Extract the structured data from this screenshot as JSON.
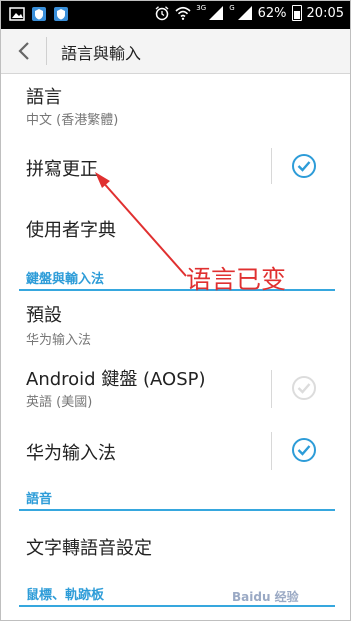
{
  "status_bar": {
    "net_3g": "3G",
    "net_g": "G",
    "battery": "62%",
    "time": "20:05"
  },
  "action_bar": {
    "title": "語言與輸入"
  },
  "items": {
    "language": {
      "title": "語言",
      "summary": "中文 (香港繁體)"
    },
    "spell": {
      "title": "拼寫更正",
      "checked": true
    },
    "dict": {
      "title": "使用者字典"
    },
    "default_ime": {
      "title": "預設",
      "summary": "华为输入法"
    },
    "aosp": {
      "title": "Android 鍵盤 (AOSP)",
      "summary": "英語 (美國)",
      "checked": true,
      "enabled": false
    },
    "huawei": {
      "title": "华为输入法",
      "checked": true
    }
  },
  "sections": {
    "keyboard": "鍵盤與輸入法",
    "speech": "語音",
    "tts": "文字轉語音設定",
    "mouse": "鼠標、軌跡板"
  },
  "annotation": "语言已变",
  "watermark": "Baidu 经验",
  "colors": {
    "accent": "#2d9cd8",
    "annotation": "#e03030"
  }
}
